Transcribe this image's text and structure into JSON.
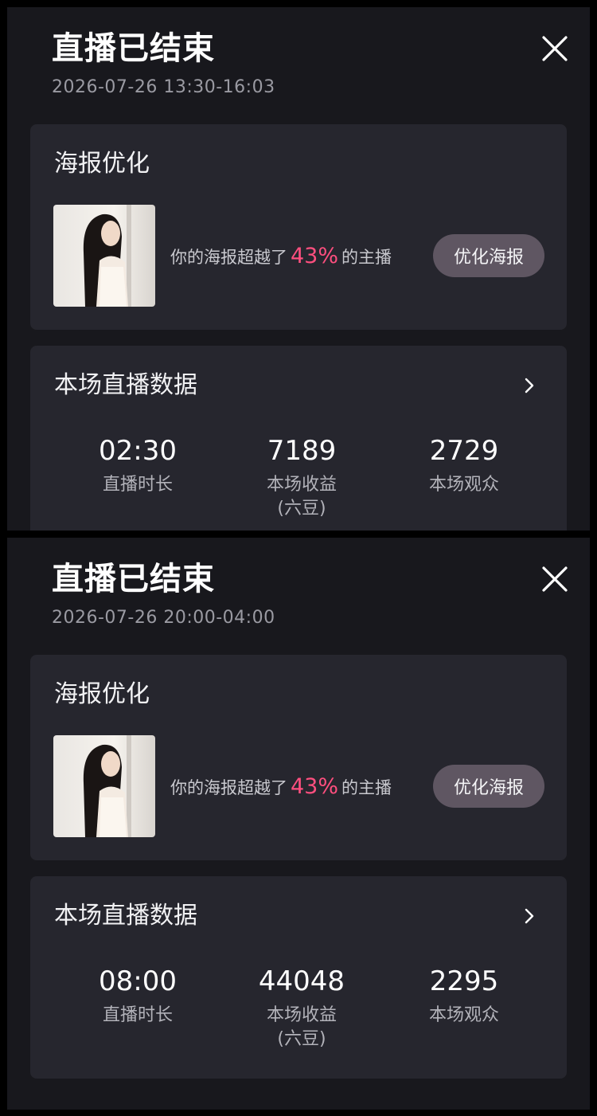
{
  "screens": [
    {
      "title": "直播已结束",
      "time_range": "2026-07-26 13:30-16:03",
      "poster": {
        "title": "海报优化",
        "text_prefix": "你的海报超越了",
        "percent": "43%",
        "text_suffix": "的主播",
        "button": "优化海报"
      },
      "stats": {
        "title": "本场直播数据",
        "duration": {
          "value": "02:30",
          "label": "直播时长"
        },
        "revenue": {
          "value": "7189",
          "label": "本场收益",
          "unit": "(六豆)"
        },
        "audience": {
          "value": "2729",
          "label": "本场观众"
        }
      }
    },
    {
      "title": "直播已结束",
      "time_range": "2026-07-26 20:00-04:00",
      "poster": {
        "title": "海报优化",
        "text_prefix": "你的海报超越了",
        "percent": "43%",
        "text_suffix": "的主播",
        "button": "优化海报"
      },
      "stats": {
        "title": "本场直播数据",
        "duration": {
          "value": "08:00",
          "label": "直播时长"
        },
        "revenue": {
          "value": "44048",
          "label": "本场收益",
          "unit": "(六豆)"
        },
        "audience": {
          "value": "2295",
          "label": "本场观众"
        }
      }
    }
  ],
  "colors": {
    "accent_pink": "#ff4f7f",
    "button_bg": "#5f5662",
    "card_bg": "#26262e",
    "screen_bg": "#18181d"
  },
  "icons": {
    "close": "close-icon",
    "chevron": "chevron-right-icon"
  }
}
